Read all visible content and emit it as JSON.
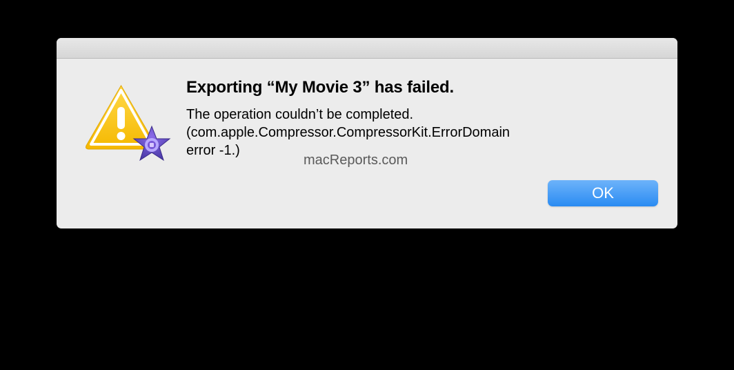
{
  "dialog": {
    "title": "Exporting “My Movie 3” has failed.",
    "message_line1": "The operation couldn’t be completed.",
    "message_line2": "(com.apple.Compressor.CompressorKit.ErrorDomain",
    "message_line3": "error -1.)",
    "ok_button": "OK"
  },
  "watermark": "macReports.com"
}
